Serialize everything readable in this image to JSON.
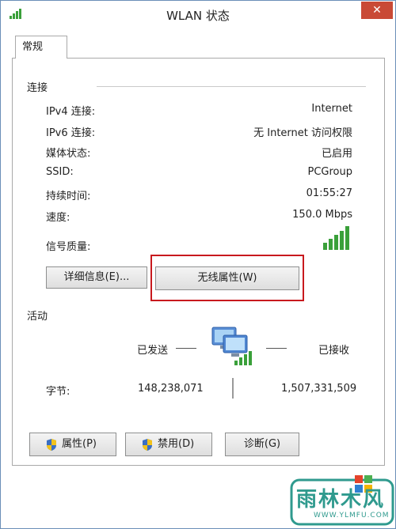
{
  "window": {
    "title": "WLAN 状态",
    "close_glyph": "✕"
  },
  "tabs": [
    {
      "label": "常规"
    }
  ],
  "connection": {
    "section_label": "连接",
    "rows": [
      {
        "label": "IPv4 连接:",
        "value": "Internet"
      },
      {
        "label": "IPv6 连接:",
        "value": "无 Internet 访问权限"
      },
      {
        "label": "媒体状态:",
        "value": "已启用"
      },
      {
        "label": "SSID:",
        "value": "PCGroup"
      },
      {
        "label": "持续时间:",
        "value": "01:55:27"
      },
      {
        "label": "速度:",
        "value": "150.0 Mbps"
      }
    ],
    "signal_label": "信号质量:",
    "signal_bars": 5,
    "details_button": "详细信息(E)...",
    "wireless_props_button": "无线属性(W)"
  },
  "activity": {
    "section_label": "活动",
    "sent_label": "已发送",
    "received_label": "已接收",
    "bytes_label": "字节:",
    "bytes_sent": "148,238,071",
    "bytes_received": "1,507,331,509"
  },
  "buttons": {
    "properties": "属性(P)",
    "disable": "禁用(D)",
    "diagnose": "诊断(G)"
  },
  "watermark": {
    "text": "雨林木风",
    "url": "WWW.YLMFU.COM"
  },
  "colors": {
    "signal_green": "#3aa03a",
    "highlight_red": "#c8191e",
    "close_red": "#c94a36",
    "shield_blue": "#3a6fc4",
    "shield_yellow": "#f2c21b"
  }
}
